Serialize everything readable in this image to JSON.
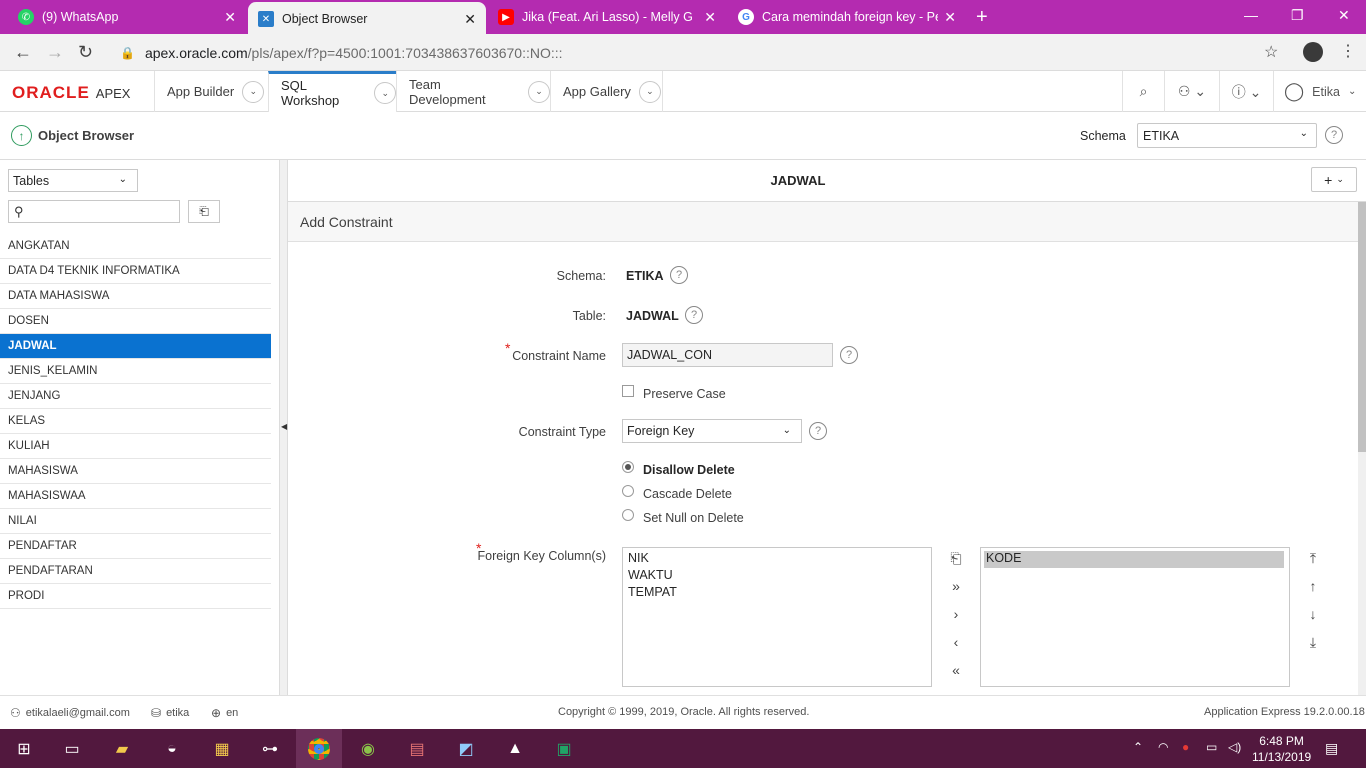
{
  "browser": {
    "tabs": [
      {
        "label": "(9) WhatsApp",
        "icon": "whatsapp-icon",
        "color": "#25d366"
      },
      {
        "label": "Object Browser",
        "icon": "apex-icon",
        "color": "#2a7dc9"
      },
      {
        "label": "Jika (Feat. Ari Lasso) - Melly G",
        "icon": "youtube-icon",
        "color": "#ff0000"
      },
      {
        "label": "Cara memindah foreign key - Per",
        "icon": "google-icon",
        "color": "#ffffff"
      }
    ],
    "url_host": "apex.oracle.com",
    "url_path": "/pls/apex/f?p=4500:1001:703438637603670::NO:::"
  },
  "apex": {
    "logo_oracle": "ORACLE",
    "logo_apex": "APEX",
    "menu": [
      "App Builder",
      "SQL Workshop",
      "Team Development",
      "App Gallery"
    ],
    "user": "Etika"
  },
  "object_browser": {
    "title": "Object Browser",
    "schema_label": "Schema",
    "schema_value": "ETIKA"
  },
  "left": {
    "object_type": "Tables",
    "search_placeholder": "",
    "tables": [
      "ANGKATAN",
      "DATA D4 TEKNIK INFORMATIKA",
      "DATA MAHASISWA",
      "DOSEN",
      "JADWAL",
      "JENIS_KELAMIN",
      "JENJANG",
      "KELAS",
      "KULIAH",
      "MAHASISWA",
      "MAHASISWAA",
      "NILAI",
      "PENDAFTAR",
      "PENDAFTARAN",
      "PRODI"
    ],
    "selected": "JADWAL"
  },
  "right": {
    "title": "JADWAL",
    "region_title": "Add Constraint",
    "schema_label": "Schema:",
    "schema_value": "ETIKA",
    "table_label": "Table:",
    "table_value": "JADWAL",
    "constraint_name_label": "Constraint Name",
    "constraint_name_value": "JADWAL_CON",
    "preserve_case_label": "Preserve Case",
    "constraint_type_label": "Constraint Type",
    "constraint_type_value": "Foreign Key",
    "delete_options": [
      "Disallow Delete",
      "Cascade Delete",
      "Set Null on Delete"
    ],
    "fk_label": "Foreign Key Column(s)",
    "available_columns": [
      "NIK",
      "WAKTU",
      "TEMPAT"
    ],
    "selected_columns": [
      "KODE"
    ]
  },
  "footer": {
    "email": "etikalaeli@gmail.com",
    "workspace": "etika",
    "language": "en",
    "copyright": "Copyright © 1999, 2019, Oracle. All rights reserved.",
    "version": "Application Express 19.2.0.00.18"
  },
  "taskbar": {
    "time": "6:48 PM",
    "date": "11/13/2019"
  }
}
